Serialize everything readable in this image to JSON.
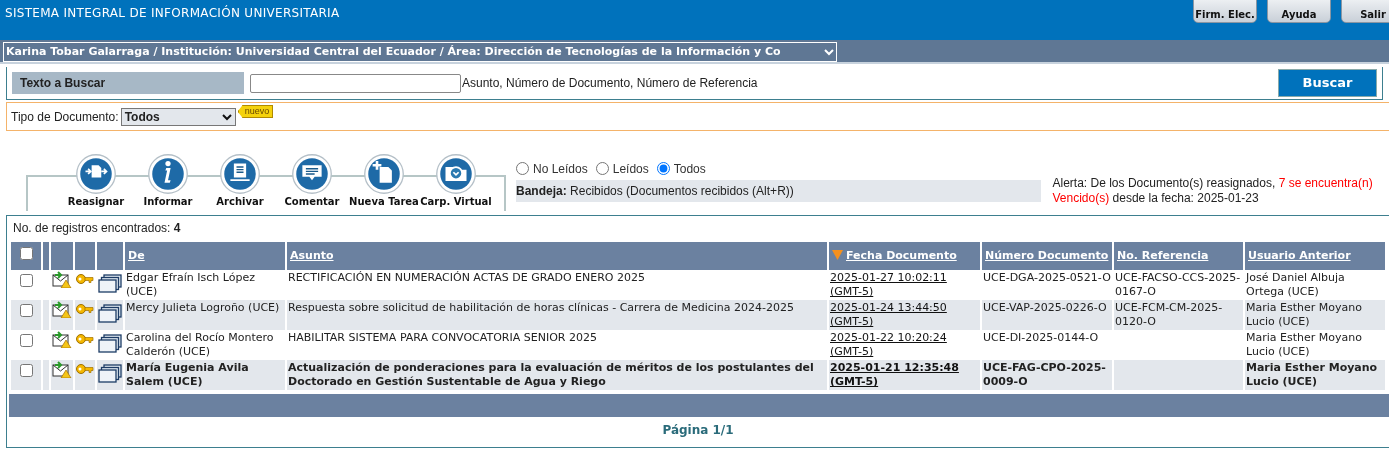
{
  "header": {
    "title": "SISTEMA INTEGRAL DE INFORMACIÓN UNIVERSITARIA",
    "buttons": [
      "Firm. Elec.",
      "Ayuda",
      "Salir"
    ]
  },
  "context_select": {
    "value": "Karina Tobar Galarraga / Institución: Universidad Central del Ecuador / Área: Dirección de Tecnologías de la Información y Co"
  },
  "search": {
    "label": "Texto a Buscar",
    "hint": "Asunto, Número de Documento, Número de Referencia",
    "button": "Buscar"
  },
  "doc_type": {
    "label": "Tipo de Documento:",
    "value": "Todos",
    "badge": "nuevo"
  },
  "tools": [
    "Reasignar",
    "Informar",
    "Archivar",
    "Comentar",
    "Nueva Tarea",
    "Carp. Virtual"
  ],
  "filters": [
    {
      "label": "No Leídos",
      "selected": false
    },
    {
      "label": "Leídos",
      "selected": false
    },
    {
      "label": "Todos",
      "selected": true
    }
  ],
  "tray": "**Bandeja:** Recibidos (Documentos recibidos (Alt+R))",
  "alert": [
    {
      "text": "Alerta: De los Documento(s) reasignados, ",
      "kind": "normal"
    },
    {
      "text": "7 se encuentra(n) Vencido(s)",
      "kind": "warning"
    },
    {
      "text": " desde la fecha: 2025-01-23",
      "kind": "normal"
    }
  ],
  "count": "No. de registros encontrados: **4**",
  "table": {
    "select_all": false,
    "columns": [
      {
        "label": "De",
        "sorted": false
      },
      {
        "label": "Asunto",
        "sorted": false
      },
      {
        "label": "Fecha Documento",
        "sorted": true
      },
      {
        "label": "Número Documento",
        "sorted": false
      },
      {
        "label": "No. Referencia",
        "sorted": false
      },
      {
        "label": "Usuario Anterior",
        "sorted": false
      }
    ],
    "rows": [
      {
        "checked": false,
        "unread": false,
        "cells": [
          "Edgar Efraín Isch López (UCE)",
          "RECTIFICACIÓN EN NUMERACIÓN ACTAS DE GRADO ENERO 2025",
          "2025-01-27 10:02:11 (GMT-5)",
          "UCE-DGA-2025-0521-O",
          "UCE-FACSO-CCS-2025-0167-O",
          "José Daniel Albuja Ortega (UCE)"
        ]
      },
      {
        "checked": false,
        "unread": false,
        "cells": [
          "Mercy Julieta Logroño (UCE)",
          "Respuesta sobre solicitud de habilitación de horas clínicas - Carrera de Medicina 2024-2025",
          "2025-01-24 13:44:50 (GMT-5)",
          "UCE-VAP-2025-0226-O",
          "UCE-FCM-CM-2025-0120-O",
          "Maria Esther Moyano Lucio (UCE)"
        ]
      },
      {
        "checked": false,
        "unread": false,
        "cells": [
          "Carolina del Rocío Montero Calderón (UCE)",
          "HABILITAR SISTEMA PARA CONVOCATORIA SENIOR 2025",
          "2025-01-22 10:20:24 (GMT-5)",
          "UCE-DI-2025-0144-O",
          null,
          "Maria Esther Moyano Lucio (UCE)"
        ]
      },
      {
        "checked": false,
        "unread": true,
        "cells": [
          "María Eugenia Avila Salem (UCE)",
          "Actualización de ponderaciones para la evaluación de méritos de los postulantes del Doctorado en Gestión Sustentable de Agua y Riego",
          "2025-01-21 12:35:48 (GMT-5)",
          "UCE-FAG-CPO-2025-0009-O",
          null,
          "Maria Esther Moyano Lucio (UCE)"
        ]
      }
    ]
  },
  "pagination": "Página 1/1"
}
